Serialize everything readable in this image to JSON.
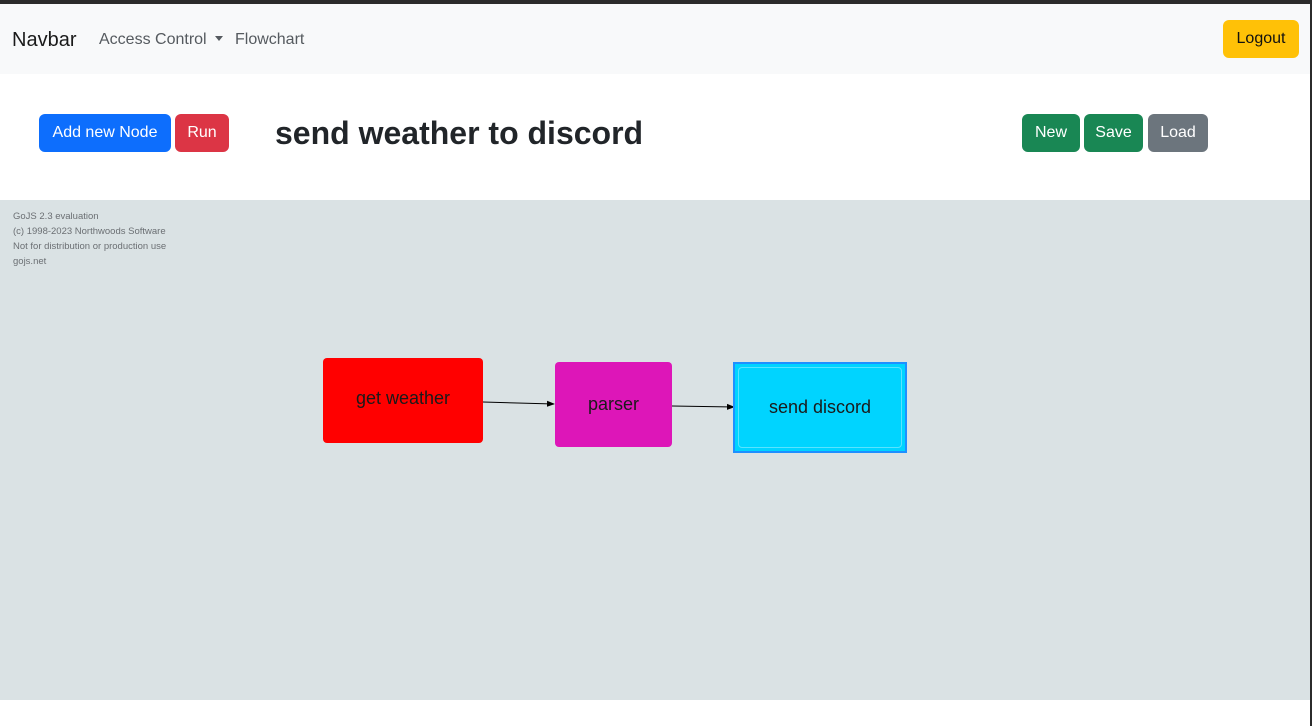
{
  "navbar": {
    "brand": "Navbar",
    "items": [
      {
        "label": "Access Control",
        "dropdown": true
      },
      {
        "label": "Flowchart"
      }
    ],
    "logout_label": "Logout"
  },
  "toolbar": {
    "add_node_label": "Add new Node",
    "run_label": "Run",
    "new_label": "New",
    "save_label": "Save",
    "load_label": "Load"
  },
  "flow": {
    "title": "send weather to discord"
  },
  "diagram": {
    "watermark": [
      "GoJS 2.3 evaluation",
      "(c) 1998-2023 Northwoods Software",
      "Not for distribution or production use",
      "gojs.net"
    ],
    "nodes": [
      {
        "label": "get weather",
        "color": "#ff0000"
      },
      {
        "label": "parser",
        "color": "#dd16b8"
      },
      {
        "label": "send discord",
        "color": "#00d4ff",
        "selected": true
      }
    ],
    "links": [
      {
        "from": "get weather",
        "to": "parser"
      },
      {
        "from": "parser",
        "to": "send discord"
      }
    ]
  },
  "colors": {
    "primary": "#0d6efd",
    "danger": "#dc3545",
    "success": "#198754",
    "secondary": "#6c757d",
    "warning": "#ffc107",
    "canvas": "#dae2e4"
  }
}
